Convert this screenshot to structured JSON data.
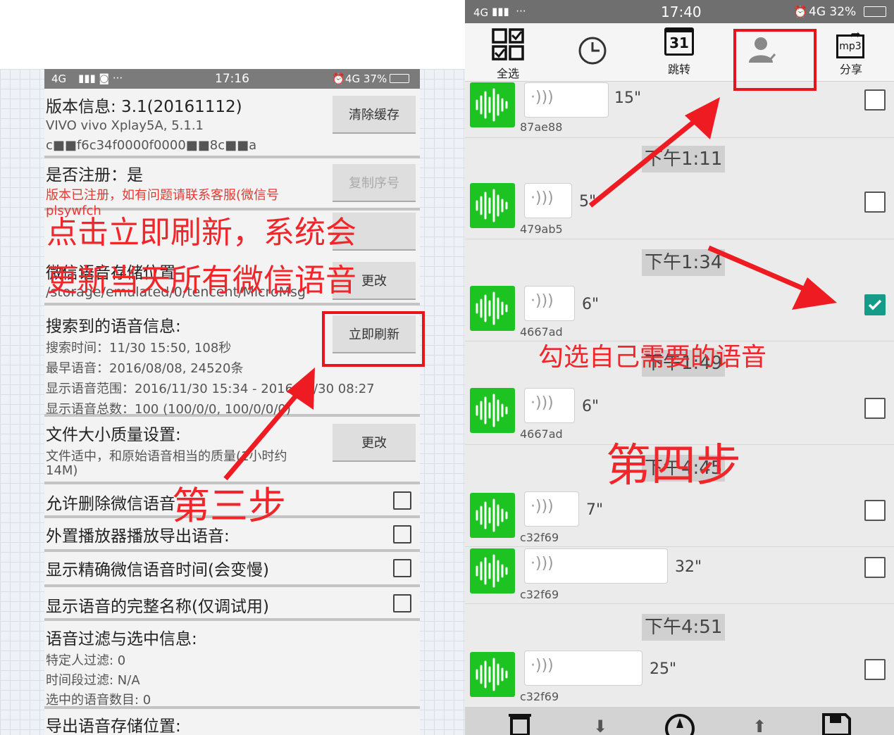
{
  "left": {
    "status": {
      "network": "4G",
      "time": "17:16",
      "battery": "4G 37%"
    },
    "version": {
      "title": "版本信息: 3.1(20161112)",
      "device": "VIVO vivo Xplay5A, 5.1.1",
      "id": "c■■f6c34f0000f0000■■8c■■a",
      "button": "清除缓存"
    },
    "register": {
      "title": "是否注册：是",
      "note_line1": "版本已注册，如有问题请联系客服(微信号",
      "note_line2": "plsywfch",
      "button": "复制序号"
    },
    "storage": {
      "title": "微信语音存储位置",
      "path": "/storage/emulated/0/tencent/MicroMsg",
      "button": "更改"
    },
    "search": {
      "title": "搜索到的语音信息:",
      "lines": [
        "搜索时间：11/30 15:50, 108秒",
        "最早语音：2016/08/08, 24520条",
        "显示语音范围：2016/11/30 15:34 - 2016/11/30 08:27",
        "显示语音总数：100 (100/0/0, 100/0/0/0)"
      ],
      "button": "立即刷新"
    },
    "quality": {
      "title": "文件大小质量设置:",
      "line1": "文件适中，和原始语音相当的质量(1小时约",
      "line2": "14M)",
      "button": "更改"
    },
    "toggles": [
      "允许删除微信语音",
      "外置播放器播放导出语音:",
      "显示精确微信语音时间(会变慢)",
      "显示语音的完整名称(仅调试用)"
    ],
    "filter": {
      "title": "语音过滤与选中信息:",
      "lines": [
        "特定人过滤: 0",
        "时间段过滤: N/A",
        "选中的语音数目: 0"
      ]
    },
    "export": {
      "title": "导出语音存储位置:"
    }
  },
  "right": {
    "status": {
      "network": "4G",
      "time": "17:40",
      "battery": "4G 32%"
    },
    "toolbar": {
      "select_all": "全选",
      "calendar_day": "31",
      "jump": "跳转",
      "share": "分享",
      "mp3": "mp3"
    },
    "items": [
      {
        "duration": "15\"",
        "id": "87ae88",
        "checked": false,
        "timestamp": ""
      },
      {
        "duration": "5\"",
        "id": "479ab5",
        "checked": false,
        "timestamp": "下午1:11"
      },
      {
        "duration": "6\"",
        "id": "4667ad",
        "checked": true,
        "timestamp": "下午1:34"
      },
      {
        "duration": "6\"",
        "id": "4667ad",
        "checked": false,
        "timestamp": "下午1:49"
      },
      {
        "duration": "7\"",
        "id": "c32f69",
        "checked": false,
        "timestamp": "下午4:45"
      },
      {
        "duration": "32\"",
        "id": "c32f69",
        "checked": false,
        "timestamp": ""
      },
      {
        "duration": "25\"",
        "id": "c32f69",
        "checked": false,
        "timestamp": "下午4:51"
      }
    ]
  },
  "annotations": {
    "refresh_line1": "点击立即刷新，系统会",
    "refresh_line2": "更新当天所有微信语音",
    "step3": "第三步",
    "select_hint": "勾选自己需要的语音",
    "step4": "第四步"
  },
  "colors": {
    "annotation_red": "#f0262a",
    "voice_green": "#1dc321",
    "check_teal": "#159c88"
  }
}
